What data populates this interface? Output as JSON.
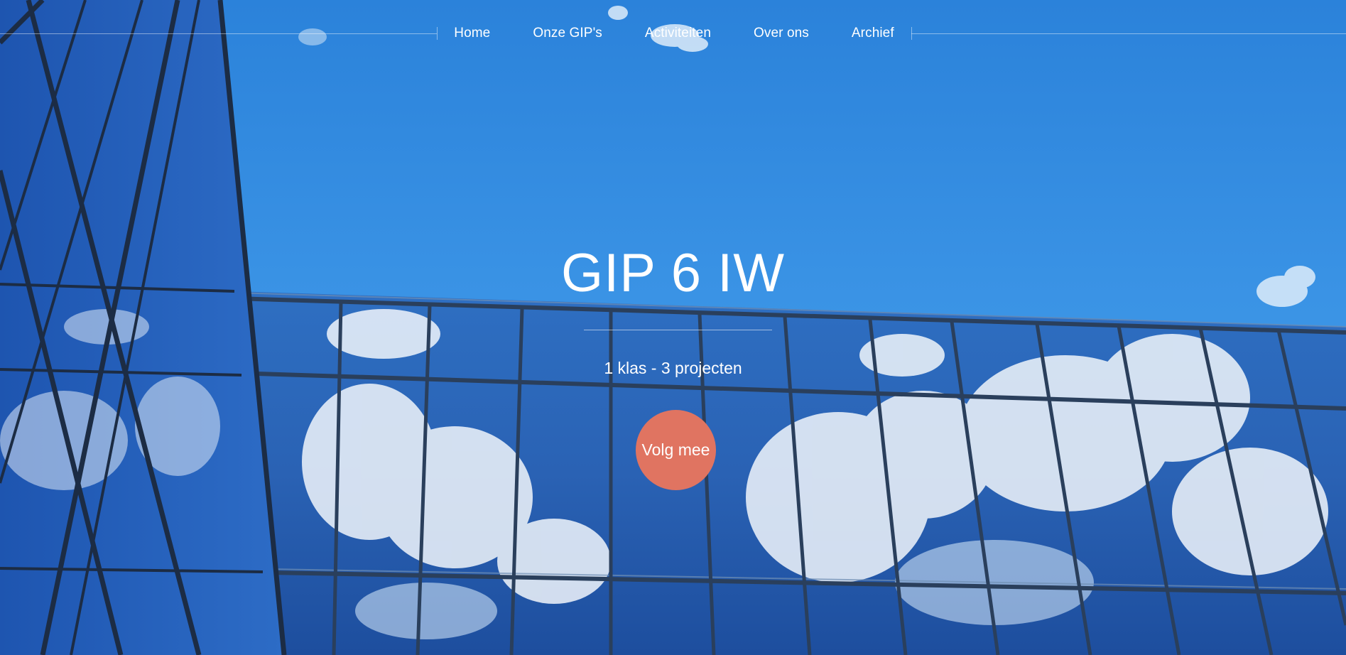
{
  "nav": {
    "items": [
      {
        "label": "Home"
      },
      {
        "label": "Onze GIP's"
      },
      {
        "label": "Activiteiten"
      },
      {
        "label": "Over ons"
      },
      {
        "label": "Archief"
      }
    ]
  },
  "hero": {
    "title": "GIP 6 IW",
    "subtitle": "1 klas - 3 projecten",
    "cta_label": "Volg mee",
    "background": "sky-reflected-in-glass-building-photo"
  },
  "colors": {
    "sky": "#2f86dc",
    "cta": "#e07461",
    "text": "#ffffff"
  }
}
